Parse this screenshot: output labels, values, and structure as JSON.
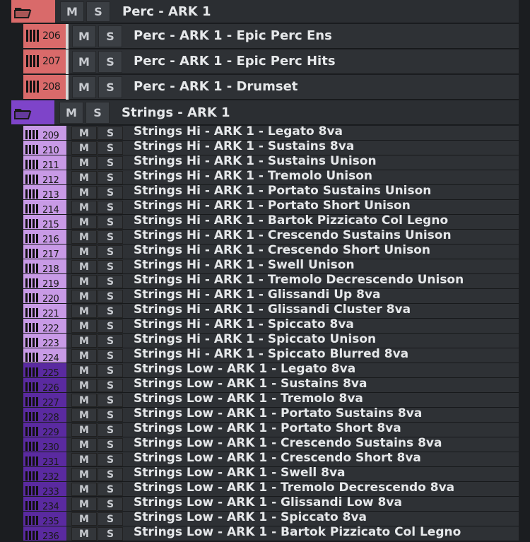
{
  "buttons": {
    "mute": "M",
    "solo": "S"
  },
  "colors": {
    "perc": "#d96a6a",
    "strings_hi": "#c89ae6",
    "strings_low": "#5a2aa0",
    "folder_strings": "#7e44c9"
  },
  "folders": [
    {
      "name": "Perc - ARK 1",
      "icon": "folder-icon"
    },
    {
      "name": "Strings - ARK 1",
      "icon": "folder-icon"
    }
  ],
  "perc_tracks": [
    {
      "num": "206",
      "name": "Perc - ARK 1 - Epic Perc Ens"
    },
    {
      "num": "207",
      "name": "Perc - ARK 1 - Epic Perc Hits"
    },
    {
      "num": "208",
      "name": "Perc - ARK 1 - Drumset"
    }
  ],
  "string_tracks": [
    {
      "num": "209",
      "name": "Strings Hi - ARK 1 - Legato 8va"
    },
    {
      "num": "210",
      "name": "Strings Hi - ARK 1 - Sustains 8va"
    },
    {
      "num": "211",
      "name": "Strings Hi - ARK 1 - Sustains Unison"
    },
    {
      "num": "212",
      "name": "Strings Hi - ARK 1 - Tremolo Unison"
    },
    {
      "num": "213",
      "name": "Strings Hi - ARK 1 - Portato Sustains Unison"
    },
    {
      "num": "214",
      "name": "Strings Hi - ARK 1 - Portato Short Unison"
    },
    {
      "num": "215",
      "name": "Strings Hi - ARK 1 - Bartok Pizzicato Col Legno"
    },
    {
      "num": "216",
      "name": "Strings Hi - ARK 1 - Crescendo Sustains Unison"
    },
    {
      "num": "217",
      "name": "Strings Hi - ARK 1 - Crescendo Short Unison"
    },
    {
      "num": "218",
      "name": "Strings Hi - ARK 1 - Swell Unison"
    },
    {
      "num": "219",
      "name": "Strings Hi - ARK 1 - Tremolo Decrescendo Unison"
    },
    {
      "num": "220",
      "name": "Strings Hi - ARK 1 - Glissandi Up 8va"
    },
    {
      "num": "221",
      "name": "Strings Hi - ARK 1 - Glissandi Cluster 8va"
    },
    {
      "num": "222",
      "name": "Strings Hi - ARK 1 - Spiccato 8va"
    },
    {
      "num": "223",
      "name": "Strings Hi - ARK 1 - Spiccato Unison"
    },
    {
      "num": "224",
      "name": "Strings Hi - ARK 1 - Spiccato Blurred 8va"
    },
    {
      "num": "225",
      "name": "Strings Low - ARK 1 - Legato 8va"
    },
    {
      "num": "226",
      "name": "Strings Low - ARK 1 - Sustains 8va"
    },
    {
      "num": "227",
      "name": "Strings Low - ARK 1 - Tremolo 8va"
    },
    {
      "num": "228",
      "name": "Strings Low - ARK 1 - Portato Sustains 8va"
    },
    {
      "num": "229",
      "name": "Strings Low - ARK 1 - Portato Short 8va"
    },
    {
      "num": "230",
      "name": "Strings Low - ARK 1 - Crescendo Sustains 8va"
    },
    {
      "num": "231",
      "name": "Strings Low - ARK 1 - Crescendo Short 8va"
    },
    {
      "num": "232",
      "name": "Strings Low - ARK 1 - Swell 8va"
    },
    {
      "num": "233",
      "name": "Strings Low - ARK 1 - Tremolo Decrescendo 8va"
    },
    {
      "num": "234",
      "name": "Strings Low - ARK 1 - Glissandi Low 8va"
    },
    {
      "num": "235",
      "name": "Strings Low - ARK 1 - Spiccato 8va"
    },
    {
      "num": "236",
      "name": "Strings Low - ARK 1 - Bartok Pizzicato Col Legno"
    }
  ]
}
